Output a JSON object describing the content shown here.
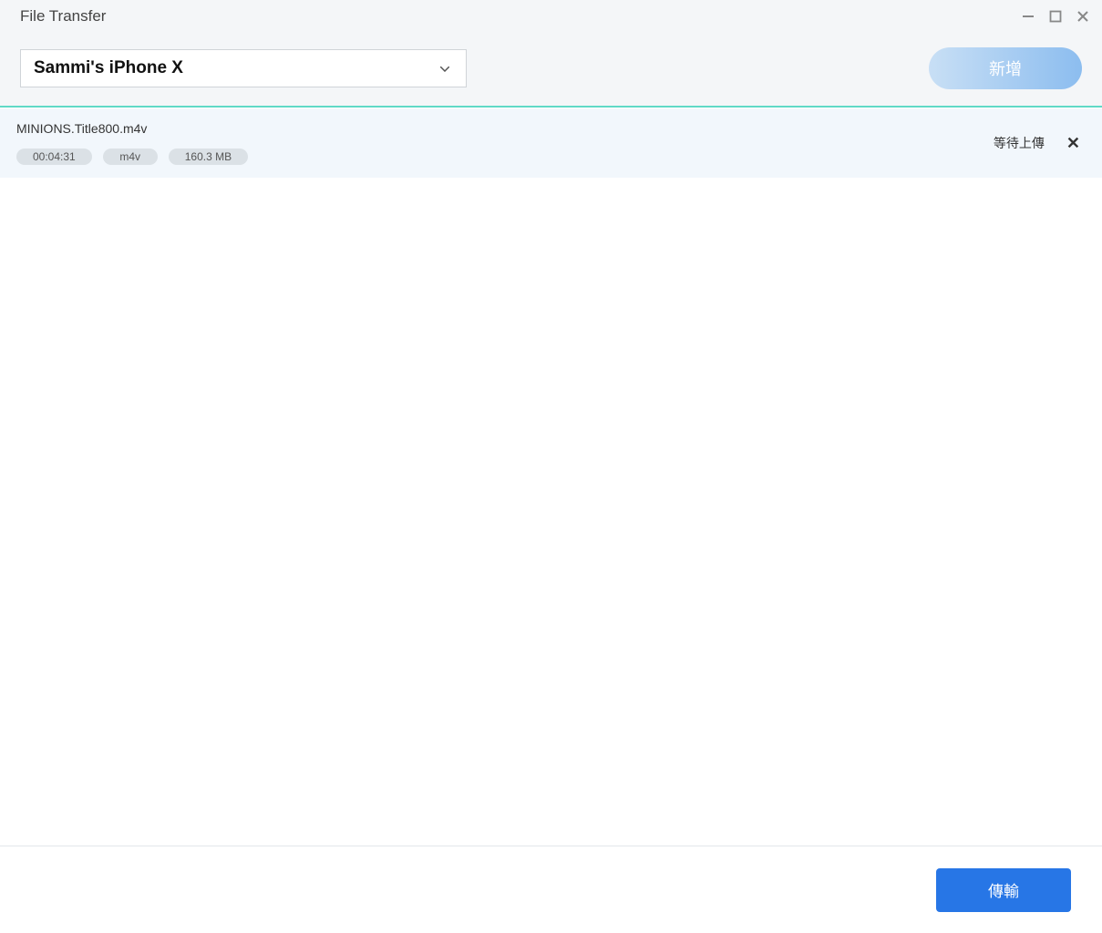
{
  "app": {
    "title": "File Transfer"
  },
  "toolbar": {
    "device_selected": "Sammi's iPhone X",
    "add_label": "新增"
  },
  "files": [
    {
      "name": "MINIONS.Title800.m4v",
      "duration": "00:04:31",
      "format": "m4v",
      "size": "160.3 MB",
      "status": "等待上傳"
    }
  ],
  "footer": {
    "transfer_label": "傳輸"
  }
}
